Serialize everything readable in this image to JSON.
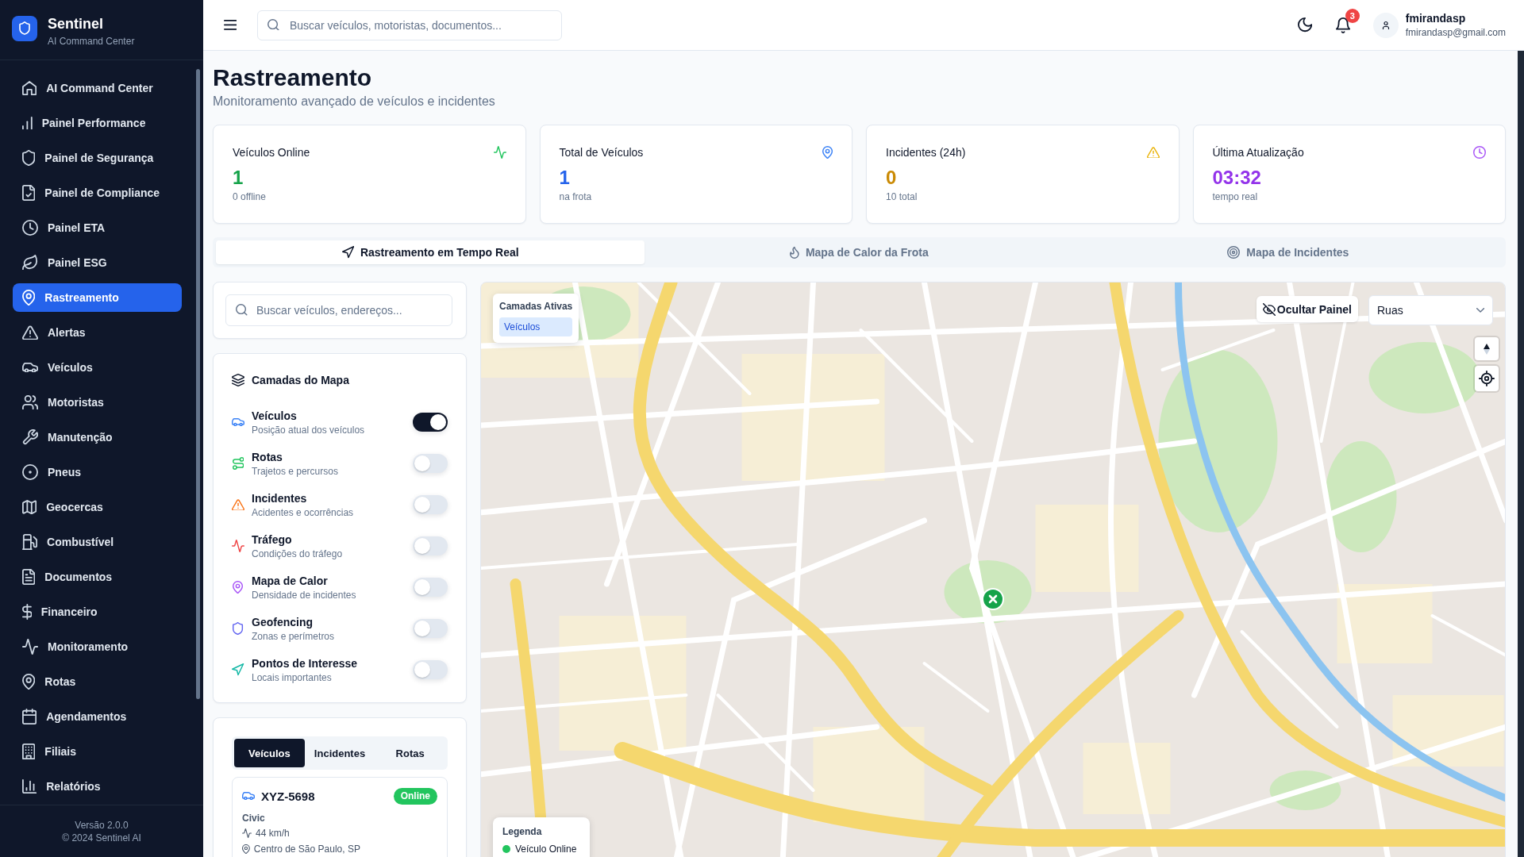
{
  "sidebar": {
    "brand": {
      "name": "Sentinel",
      "tagline": "AI Command Center"
    },
    "items": [
      {
        "label": "AI Command Center",
        "selected": false
      },
      {
        "label": "Painel Performance",
        "selected": false
      },
      {
        "label": "Painel de Segurança",
        "selected": false
      },
      {
        "label": "Painel de Compliance",
        "selected": false
      },
      {
        "label": "Painel ETA",
        "selected": false
      },
      {
        "label": "Painel ESG",
        "selected": false
      },
      {
        "label": "Rastreamento",
        "selected": true
      },
      {
        "label": "Alertas",
        "selected": false
      },
      {
        "label": "Veículos",
        "selected": false
      },
      {
        "label": "Motoristas",
        "selected": false
      },
      {
        "label": "Manutenção",
        "selected": false
      },
      {
        "label": "Pneus",
        "selected": false
      },
      {
        "label": "Geocercas",
        "selected": false
      },
      {
        "label": "Combustível",
        "selected": false
      },
      {
        "label": "Documentos",
        "selected": false
      },
      {
        "label": "Financeiro",
        "selected": false
      },
      {
        "label": "Monitoramento",
        "selected": false
      },
      {
        "label": "Rotas",
        "selected": false
      },
      {
        "label": "Agendamentos",
        "selected": false
      },
      {
        "label": "Filiais",
        "selected": false
      },
      {
        "label": "Relatórios",
        "selected": false
      }
    ],
    "footer": {
      "version": "Versão 2.0.0",
      "copyright": "© 2024 Sentinel AI"
    }
  },
  "header": {
    "search": {
      "placeholder": "Buscar veículos, motoristas, documentos..."
    },
    "notifications": {
      "count": "3"
    },
    "user": {
      "name": "fmirandasp",
      "email": "fmirandasp@gmail.com"
    }
  },
  "page": {
    "title": "Rastreamento",
    "subtitle": "Monitoramento avançado de veículos e incidentes"
  },
  "stats": [
    {
      "label": "Veículos Online",
      "value": "1",
      "note": "0 offline"
    },
    {
      "label": "Total de Veículos",
      "value": "1",
      "note": "na frota"
    },
    {
      "label": "Incidentes (24h)",
      "value": "0",
      "note": "10 total"
    },
    {
      "label": "Última Atualização",
      "value": "03:32",
      "note": "tempo real"
    }
  ],
  "view_tabs": [
    {
      "label": "Rastreamento em Tempo Real",
      "selected": true
    },
    {
      "label": "Mapa de Calor da Frota",
      "selected": false
    },
    {
      "label": "Mapa de Incidentes",
      "selected": false
    }
  ],
  "search": {
    "placeholder": "Buscar veículos, endereços..."
  },
  "layers": {
    "title": "Camadas do Mapa",
    "items": [
      {
        "name": "Veículos",
        "description": "Posição atual dos veículos",
        "on": true
      },
      {
        "name": "Rotas",
        "description": "Trajetos e percursos",
        "on": false
      },
      {
        "name": "Incidentes",
        "description": "Acidentes e ocorrências",
        "on": false
      },
      {
        "name": "Tráfego",
        "description": "Condições do tráfego",
        "on": false
      },
      {
        "name": "Mapa de Calor",
        "description": "Densidade de incidentes",
        "on": false
      },
      {
        "name": "Geofencing",
        "description": "Zonas e perímetros",
        "on": false
      },
      {
        "name": "Pontos de Interesse",
        "description": "Locais importantes",
        "on": false
      }
    ]
  },
  "list": {
    "tabs": [
      {
        "label": "Veículos",
        "selected": true
      },
      {
        "label": "Incidentes",
        "selected": false
      },
      {
        "label": "Rotas",
        "selected": false
      }
    ],
    "vehicles": [
      {
        "plate": "XYZ-5698",
        "status": "Online",
        "online": true,
        "model": "Civic",
        "speed": "44 km/h",
        "location": "Centro de São Paulo, SP"
      }
    ]
  },
  "map": {
    "active_layers": {
      "title": "Camadas Ativas",
      "items": [
        "Veículos"
      ]
    },
    "hide_panel": "Ocultar Painel",
    "style_select": {
      "value": "Ruas"
    },
    "legend": {
      "title": "Legenda",
      "items": [
        {
          "label": "Veículo Online",
          "color": "#22c55e"
        }
      ]
    }
  }
}
